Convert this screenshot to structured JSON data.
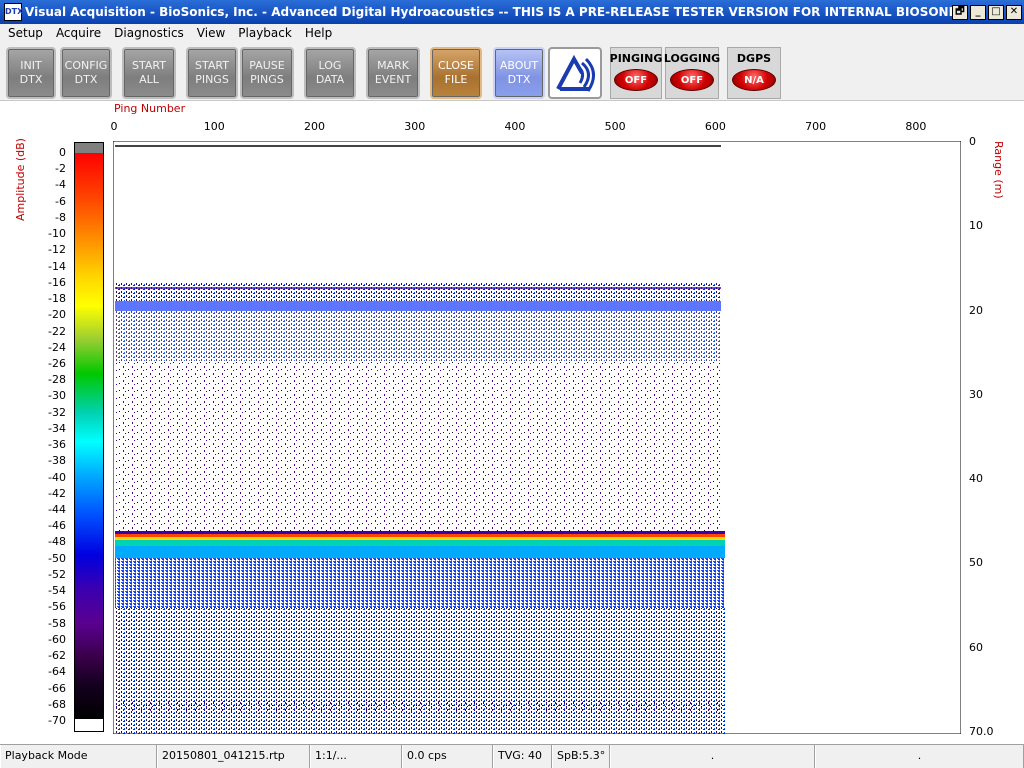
{
  "window": {
    "title": "Visual Acquisition  -  BioSonics, Inc.  -  Advanced Digital Hydroacoustics  -- THIS IS A PRE-RELEASE TESTER VERSION FOR INTERNAL BIOSONICS USE ONLY",
    "icon_text": "DTX",
    "controls": {
      "restore": "🗗",
      "minimize": "_",
      "maximize": "□",
      "close": "✕"
    }
  },
  "menu": [
    "Setup",
    "Acquire",
    "Diagnostics",
    "View",
    "Playback",
    "Help"
  ],
  "toolbar": {
    "buttons": [
      {
        "id": "init-dtx",
        "label": "INIT\nDTX",
        "style": "gray"
      },
      {
        "id": "config-dtx",
        "label": "CONFIG\nDTX",
        "style": "gray"
      },
      {
        "id": "start-all",
        "label": "START\nALL",
        "style": "gray"
      },
      {
        "id": "start-pings",
        "label": "START\nPINGS",
        "style": "gray"
      },
      {
        "id": "pause-pings",
        "label": "PAUSE\nPINGS",
        "style": "gray"
      },
      {
        "id": "log-data",
        "label": "LOG\nDATA",
        "style": "gray"
      },
      {
        "id": "mark-event",
        "label": "MARK\nEVENT",
        "style": "gray"
      },
      {
        "id": "close-file",
        "label": "CLOSE\nFILE",
        "style": "close"
      },
      {
        "id": "about-dtx",
        "label": "ABOUT\nDTX",
        "style": "about"
      }
    ],
    "indicators": [
      {
        "id": "pinging",
        "label": "PINGING",
        "state": "OFF"
      },
      {
        "id": "logging",
        "label": "LOGGING",
        "state": "OFF"
      },
      {
        "id": "dgps",
        "label": "DGPS",
        "state": "N/A"
      }
    ]
  },
  "echogram": {
    "x_label": "Ping Number",
    "y_right_label": "Range (m)",
    "colorbar_label": "Amplitude (dB)",
    "x_ticks": [
      "0",
      "100",
      "200",
      "300",
      "400",
      "500",
      "600",
      "700",
      "800"
    ],
    "x_range": [
      0,
      845
    ],
    "y_range": [
      0,
      70
    ],
    "y_ticks": [
      "0",
      "10",
      "20",
      "30",
      "40",
      "50",
      "60",
      "70.0"
    ],
    "colorbar_ticks": [
      "0",
      "-2",
      "-4",
      "-6",
      "-8",
      "-10",
      "-12",
      "-14",
      "-16",
      "-18",
      "-20",
      "-22",
      "-24",
      "-26",
      "-28",
      "-30",
      "-32",
      "-34",
      "-36",
      "-38",
      "-40",
      "-42",
      "-44",
      "-46",
      "-48",
      "-50",
      "-52",
      "-54",
      "-56",
      "-58",
      "-60",
      "-62",
      "-64",
      "-66",
      "-68",
      "-70"
    ],
    "pings_recorded": 610,
    "colors": {
      "axis_label": "#c00000"
    }
  },
  "status": {
    "mode": "Playback Mode",
    "file": "20150801_041215.rtp",
    "ratio": "1:1/...",
    "rate": "0.0 cps",
    "tvg": "TVG: 40",
    "spb": "SpB:5.3°",
    "extra1": ".",
    "extra2": "."
  }
}
